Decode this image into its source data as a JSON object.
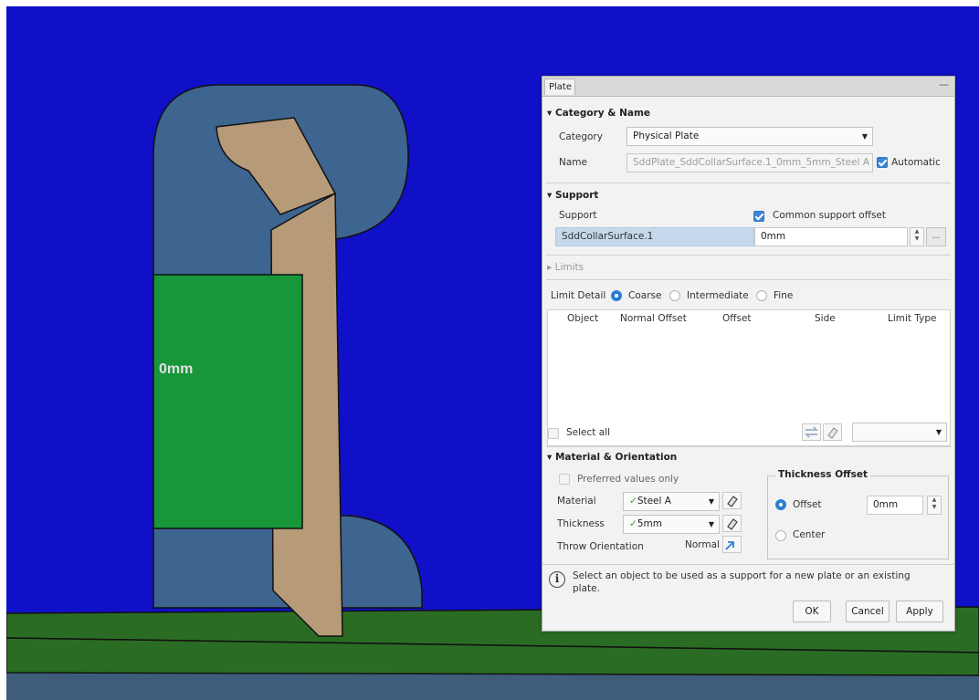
{
  "viewport": {
    "colors": {
      "background": "#1010c8",
      "ground": "#2b6c24",
      "floor": "#3f5d7a",
      "bracket": "#3e6490",
      "plate": "#17973a",
      "profile": "#b79b79"
    },
    "plate_label": "0mm"
  },
  "dialog": {
    "tab": "Plate",
    "minimize_icon": "minimize-icon",
    "category_name": {
      "title": "Category & Name",
      "category_label": "Category",
      "category_value": "Physical Plate",
      "name_label": "Name",
      "name_value": "SddPlate_SddCollarSurface.1_0mm_5mm_Steel A",
      "automatic_label": "Automatic",
      "automatic_checked": true
    },
    "support": {
      "title": "Support",
      "support_label": "Support",
      "common_offset_label": "Common support offset",
      "common_offset_checked": true,
      "support_value": "SddCollarSurface.1",
      "offset_value": "0mm",
      "browse_label": "..."
    },
    "limits": {
      "title": "Limits",
      "limit_detail_label": "Limit Detail",
      "options": [
        "Coarse",
        "Intermediate",
        "Fine"
      ],
      "selected": "Coarse",
      "columns": [
        "Object",
        "Normal Offset",
        "Offset",
        "Side",
        "Limit Type"
      ],
      "select_all_label": "Select all"
    },
    "material": {
      "title": "Material & Orientation",
      "preferred_label": "Preferred values only",
      "material_label": "Material",
      "material_value": "Steel A",
      "thickness_label": "Thickness",
      "thickness_value": "5mm",
      "throw_label": "Throw Orientation",
      "throw_value": "Normal",
      "thickness_offset": {
        "title": "Thickness Offset",
        "offset_label": "Offset",
        "offset_value": "0mm",
        "center_label": "Center",
        "selected": "Offset"
      }
    },
    "status": "Select an object to be used as a support for a new plate or an existing plate.",
    "buttons": {
      "ok": "OK",
      "cancel": "Cancel",
      "apply": "Apply"
    }
  }
}
